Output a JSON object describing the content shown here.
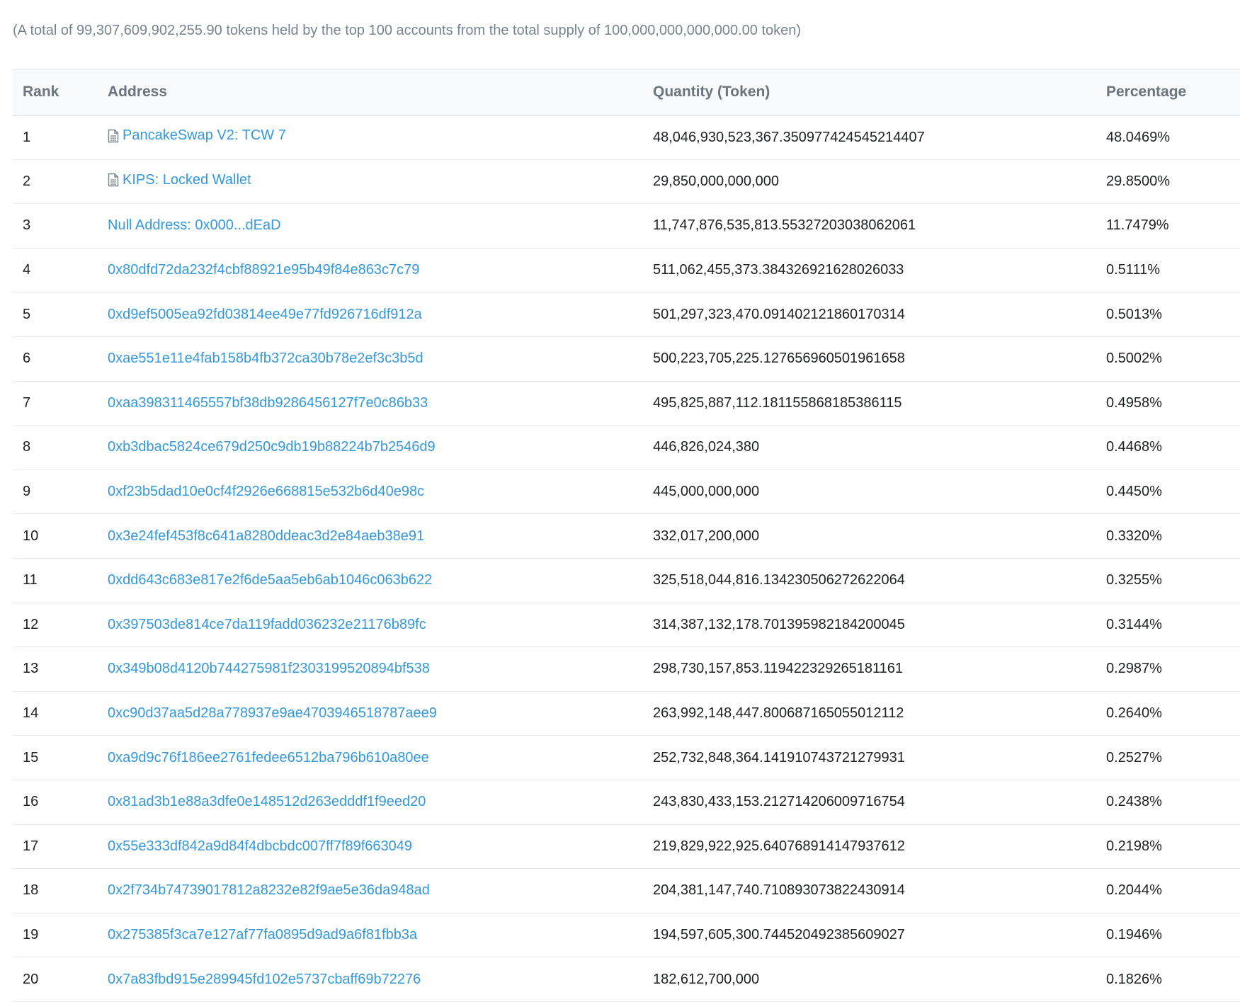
{
  "summary": "(A total of 99,307,609,902,255.90 tokens held by the top 100 accounts from the total supply of 100,000,000,000,000.00 token)",
  "table": {
    "headers": {
      "rank": "Rank",
      "address": "Address",
      "quantity": "Quantity (Token)",
      "percentage": "Percentage"
    },
    "rows": [
      {
        "rank": "1",
        "address": "PancakeSwap V2: TCW 7",
        "is_contract": true,
        "quantity": "48,046,930,523,367.350977424545214407",
        "percentage": "48.0469%"
      },
      {
        "rank": "2",
        "address": "KIPS: Locked Wallet",
        "is_contract": true,
        "quantity": "29,850,000,000,000",
        "percentage": "29.8500%"
      },
      {
        "rank": "3",
        "address": "Null Address: 0x000...dEaD",
        "is_contract": false,
        "quantity": "11,747,876,535,813.55327203038062061",
        "percentage": "11.7479%"
      },
      {
        "rank": "4",
        "address": "0x80dfd72da232f4cbf88921e95b49f84e863c7c79",
        "is_contract": false,
        "quantity": "511,062,455,373.384326921628026033",
        "percentage": "0.5111%"
      },
      {
        "rank": "5",
        "address": "0xd9ef5005ea92fd03814ee49e77fd926716df912a",
        "is_contract": false,
        "quantity": "501,297,323,470.091402121860170314",
        "percentage": "0.5013%"
      },
      {
        "rank": "6",
        "address": "0xae551e11e4fab158b4fb372ca30b78e2ef3c3b5d",
        "is_contract": false,
        "quantity": "500,223,705,225.127656960501961658",
        "percentage": "0.5002%"
      },
      {
        "rank": "7",
        "address": "0xaa398311465557bf38db9286456127f7e0c86b33",
        "is_contract": false,
        "quantity": "495,825,887,112.181155868185386115",
        "percentage": "0.4958%"
      },
      {
        "rank": "8",
        "address": "0xb3dbac5824ce679d250c9db19b88224b7b2546d9",
        "is_contract": false,
        "quantity": "446,826,024,380",
        "percentage": "0.4468%"
      },
      {
        "rank": "9",
        "address": "0xf23b5dad10e0cf4f2926e668815e532b6d40e98c",
        "is_contract": false,
        "quantity": "445,000,000,000",
        "percentage": "0.4450%"
      },
      {
        "rank": "10",
        "address": "0x3e24fef453f8c641a8280ddeac3d2e84aeb38e91",
        "is_contract": false,
        "quantity": "332,017,200,000",
        "percentage": "0.3320%"
      },
      {
        "rank": "11",
        "address": "0xdd643c683e817e2f6de5aa5eb6ab1046c063b622",
        "is_contract": false,
        "quantity": "325,518,044,816.134230506272622064",
        "percentage": "0.3255%"
      },
      {
        "rank": "12",
        "address": "0x397503de814ce7da119fadd036232e21176b89fc",
        "is_contract": false,
        "quantity": "314,387,132,178.701395982184200045",
        "percentage": "0.3144%"
      },
      {
        "rank": "13",
        "address": "0x349b08d4120b744275981f2303199520894bf538",
        "is_contract": false,
        "quantity": "298,730,157,853.119422329265181161",
        "percentage": "0.2987%"
      },
      {
        "rank": "14",
        "address": "0xc90d37aa5d28a778937e9ae4703946518787aee9",
        "is_contract": false,
        "quantity": "263,992,148,447.800687165055012112",
        "percentage": "0.2640%"
      },
      {
        "rank": "15",
        "address": "0xa9d9c76f186ee2761fedee6512ba796b610a80ee",
        "is_contract": false,
        "quantity": "252,732,848,364.141910743721279931",
        "percentage": "0.2527%"
      },
      {
        "rank": "16",
        "address": "0x81ad3b1e88a3dfe0e148512d263edddf1f9eed20",
        "is_contract": false,
        "quantity": "243,830,433,153.212714206009716754",
        "percentage": "0.2438%"
      },
      {
        "rank": "17",
        "address": "0x55e333df842a9d84f4dbcbdc007ff7f89f663049",
        "is_contract": false,
        "quantity": "219,829,922,925.640768914147937612",
        "percentage": "0.2198%"
      },
      {
        "rank": "18",
        "address": "0x2f734b74739017812a8232e82f9ae5e36da948ad",
        "is_contract": false,
        "quantity": "204,381,147,740.710893073822430914",
        "percentage": "0.2044%"
      },
      {
        "rank": "19",
        "address": "0x275385f3ca7e127af77fa0895d9ad9a6f81fbb3a",
        "is_contract": false,
        "quantity": "194,597,605,300.744520492385609027",
        "percentage": "0.1946%"
      },
      {
        "rank": "20",
        "address": "0x7a83fbd915e289945fd102e5737cbaff69b72276",
        "is_contract": false,
        "quantity": "182,612,700,000",
        "percentage": "0.1826%"
      }
    ]
  },
  "colors": {
    "link": "#3498db",
    "muted": "#77838f",
    "header_bg": "#f8f9fa",
    "border": "#e7eaf3"
  },
  "icons": {
    "contract": "document-icon"
  }
}
